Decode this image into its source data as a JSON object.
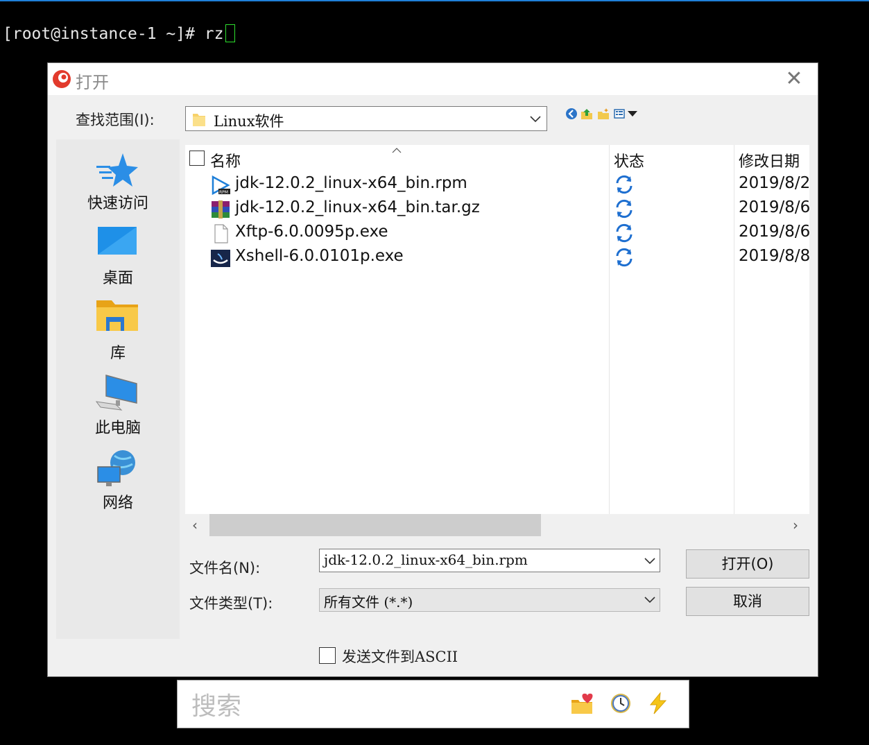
{
  "terminal": {
    "prompt": "[root@instance-1 ~]# rz"
  },
  "dialog": {
    "title": "打开",
    "close_glyph": "✕",
    "look_in_label": "查找范围(I):",
    "look_in_value": "Linux软件",
    "places": [
      {
        "label": "快速访问",
        "icon": "quick-access-star-icon"
      },
      {
        "label": "桌面",
        "icon": "desktop-icon"
      },
      {
        "label": "库",
        "icon": "library-folder-icon"
      },
      {
        "label": "此电脑",
        "icon": "this-pc-icon"
      },
      {
        "label": "网络",
        "icon": "network-icon"
      }
    ],
    "columns": {
      "name": "名称",
      "status": "状态",
      "modified": "修改日期"
    },
    "files": [
      {
        "name": "jdk-12.0.2_linux-x64_bin.rpm",
        "date": "2019/8/2",
        "icon": "rpm-file-icon"
      },
      {
        "name": "jdk-12.0.2_linux-x64_bin.tar.gz",
        "date": "2019/8/6",
        "icon": "winrar-archive-icon"
      },
      {
        "name": "Xftp-6.0.0095p.exe",
        "date": "2019/8/6",
        "icon": "blank-file-icon"
      },
      {
        "name": "Xshell-6.0.0101p.exe",
        "date": "2019/8/8",
        "icon": "xshell-app-icon"
      }
    ],
    "scroll_left": "‹",
    "scroll_right": "›",
    "filename_label": "文件名(N):",
    "filename_value": "jdk-12.0.2_linux-x64_bin.rpm",
    "filetype_label": "文件类型(T):",
    "filetype_value": "所有文件 (*.*)",
    "open_button": "打开(O)",
    "cancel_button": "取消",
    "ascii_label": "发送文件到ASCII"
  },
  "search": {
    "placeholder": "搜索"
  },
  "colors": {
    "accent": "#1e7fd8",
    "cursor": "#2ee02e"
  }
}
